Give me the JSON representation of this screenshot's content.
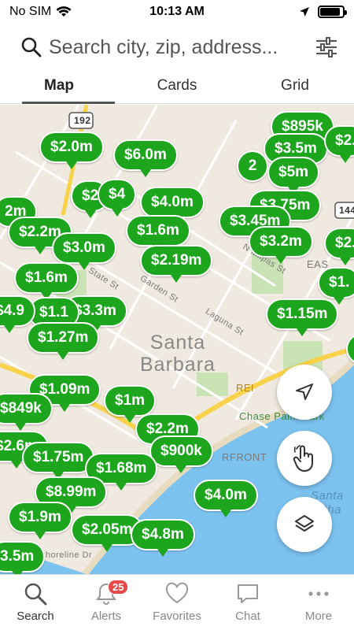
{
  "status": {
    "carrier": "No SIM",
    "time": "10:13 AM",
    "battery_level": 0.9
  },
  "search": {
    "placeholder": "Search city, zip, address..."
  },
  "tabs": [
    {
      "label": "Map"
    },
    {
      "label": "Cards"
    },
    {
      "label": "Grid"
    }
  ],
  "map": {
    "city_name": "Santa\nBarbara",
    "labels": [
      "Garden St",
      "Laguna St",
      "N Milpas St",
      "State St",
      "Shoreline Dr",
      "REI",
      "Chase Palm Park",
      "RFRONT",
      "EAS",
      "Santa",
      "Cha",
      "192",
      "144"
    ],
    "pins": [
      "$895k",
      "$3.5m",
      "$2.",
      "$2.0m",
      "$6.0m",
      "2",
      "$5m",
      "$2",
      "$4",
      "$4.0m",
      "$3.75m",
      "2m",
      "$2.2m",
      "$1.6m",
      "$3.45m",
      "$3.2m",
      "$3.0m",
      "$2.19m",
      "$2.",
      "$1.6m",
      "$3.3m",
      "$1.1",
      "$1.15m",
      "$1.27m",
      "$4.9",
      "$1.09m",
      "$849k",
      "$1m",
      "$2.2m",
      "$2.6m",
      "$900k",
      "$1.75m",
      "$1.68m",
      "$8.99m",
      "$4.0m",
      "$1.9m",
      "$2.05m",
      "$4.8m",
      "3.5m",
      "$1.",
      "$2"
    ]
  },
  "nav": [
    {
      "label": "Search",
      "icon": "search-icon"
    },
    {
      "label": "Alerts",
      "icon": "bell-icon",
      "badge": "25"
    },
    {
      "label": "Favorites",
      "icon": "heart-icon"
    },
    {
      "label": "Chat",
      "icon": "chat-icon"
    },
    {
      "label": "More",
      "icon": "more-icon"
    }
  ],
  "colors": {
    "pin_green": "#1ea51e",
    "water": "#7cc2ef",
    "park": "#c9e3b4",
    "road_yellow": "#f7d24a",
    "badge_red": "#e84a4a"
  }
}
